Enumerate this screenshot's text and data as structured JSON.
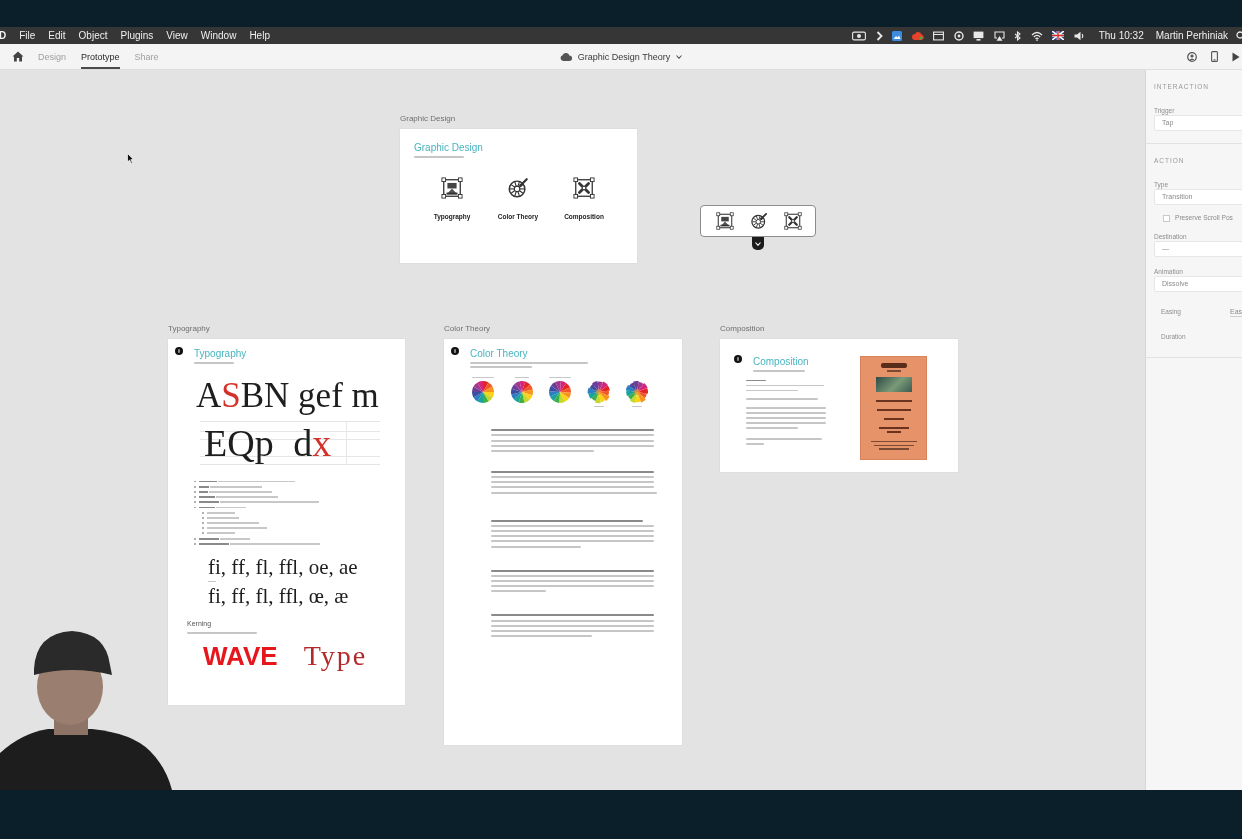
{
  "menu_bar": {
    "app": "D",
    "menus": [
      "File",
      "Edit",
      "Object",
      "Plugins",
      "View",
      "Window",
      "Help"
    ],
    "clock": "Thu 10:32",
    "user": "Martin Perhiniak"
  },
  "toolbar": {
    "tabs": [
      {
        "label": "Design",
        "selected": false
      },
      {
        "label": "Prototype",
        "selected": true
      },
      {
        "label": "Share",
        "selected": false
      }
    ],
    "document_title": "Graphic Design Theory"
  },
  "canvas": {
    "artboards": [
      {
        "kind": "home",
        "label": "Graphic Design",
        "title": "Graphic Design",
        "links": [
          {
            "kind": "type",
            "label": "Typography"
          },
          {
            "kind": "color",
            "label": "Color Theory"
          },
          {
            "kind": "layout",
            "label": "Composition"
          }
        ]
      },
      {
        "kind": "typography",
        "label": "Typography",
        "title": "Typography",
        "specimens": [
          [
            {
              "text": "A",
              "highlight": false
            },
            {
              "text": "S",
              "highlight": true
            },
            {
              "text": "BN gef m",
              "highlight": false
            }
          ],
          [
            {
              "text": "EQp d",
              "highlight": false
            },
            {
              "text": "x",
              "highlight": true
            }
          ]
        ],
        "ligatures": [
          "fi, ff, fl, ffl, oe, ae",
          "fi, ff, fl, ffl, œ, æ"
        ],
        "kerning": {
          "heading": "Kerning",
          "samples": [
            "WAVE",
            "Type"
          ]
        }
      },
      {
        "kind": "color",
        "label": "Color Theory",
        "title": "Color Theory"
      },
      {
        "kind": "composition",
        "label": "Composition",
        "title": "Composition"
      }
    ]
  },
  "inspector": {
    "disabled": true,
    "sections": [
      {
        "heading": "INTERACTION",
        "rows": [
          {
            "kind": "dropdown",
            "label": "Trigger",
            "value": "Tap"
          }
        ]
      },
      {
        "heading": "ACTION",
        "rows": [
          {
            "kind": "dropdown",
            "label": "Type",
            "value": "Transition"
          },
          {
            "kind": "checkbox",
            "label": "Preserve Scroll Pos",
            "checked": false
          },
          {
            "kind": "dropdown",
            "label": "Destination",
            "value": "—"
          },
          {
            "kind": "dropdown",
            "label": "Animation",
            "value": "Dissolve"
          },
          {
            "kind": "inline",
            "label": "Easing",
            "value": "Eas"
          },
          {
            "kind": "inline",
            "label": "Duration"
          }
        ]
      }
    ]
  }
}
